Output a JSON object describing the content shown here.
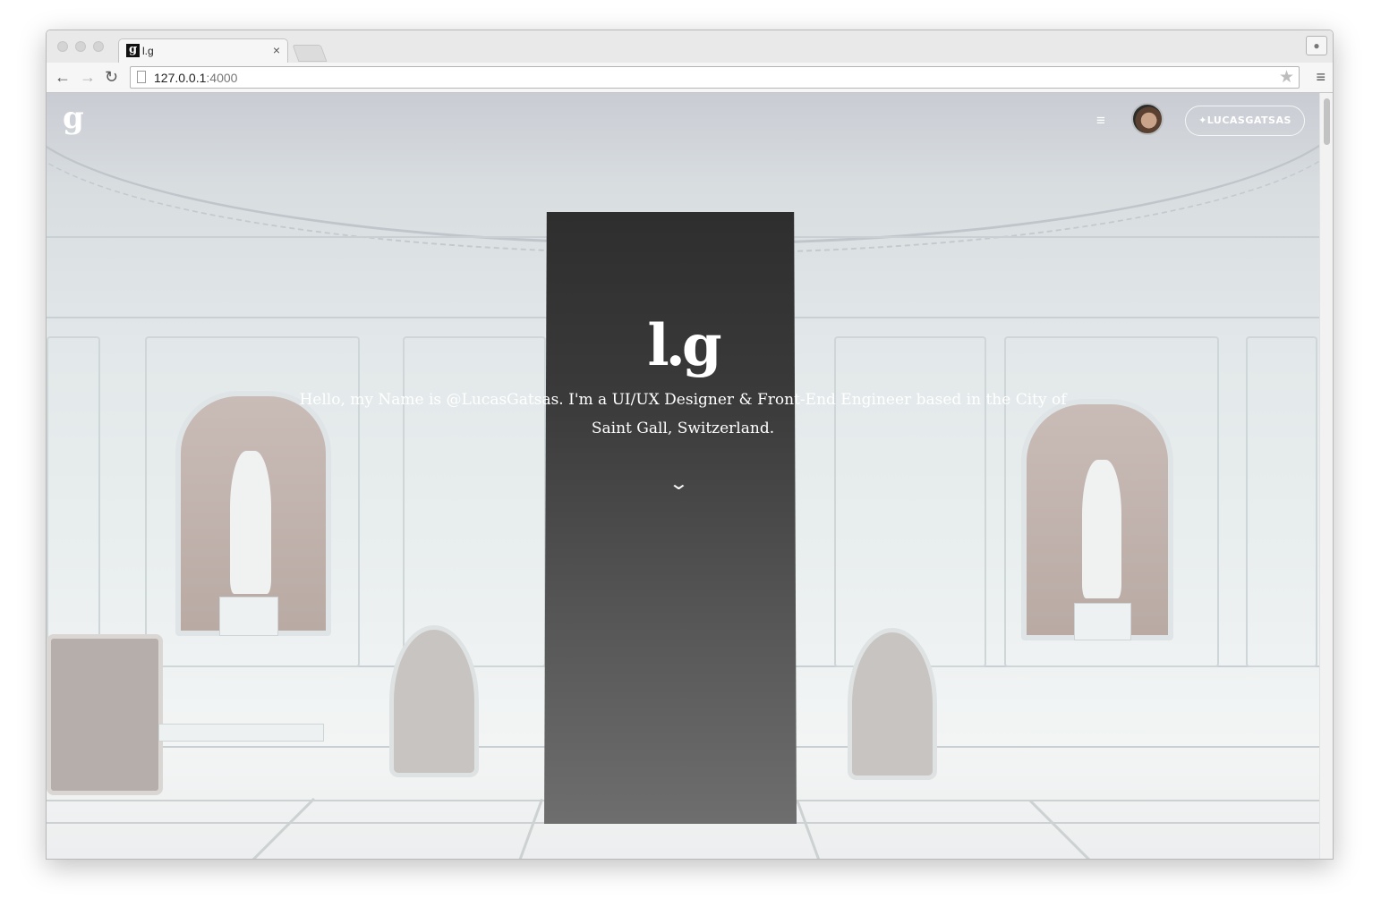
{
  "browser": {
    "tab": {
      "favicon_letter": "g",
      "title": "l.g",
      "close": "×"
    },
    "nav": {
      "back": "←",
      "forward": "→",
      "reload": "↻",
      "menu": "≡"
    },
    "url": {
      "host": "127.0.0.1",
      "port": ":4000"
    },
    "star": "★",
    "profile_icon": "person-icon"
  },
  "site": {
    "logo": "g",
    "menu_icon": "≡",
    "twitter_label": "LUCASGATSAS",
    "hero_mark": "l.g",
    "intro": "Hello, my Name is @LucasGatsas. I'm a UI/UX Designer & Front-End Engineer based in the City of Saint Gall, Switzerland.",
    "scroll_icon": "⌄"
  }
}
